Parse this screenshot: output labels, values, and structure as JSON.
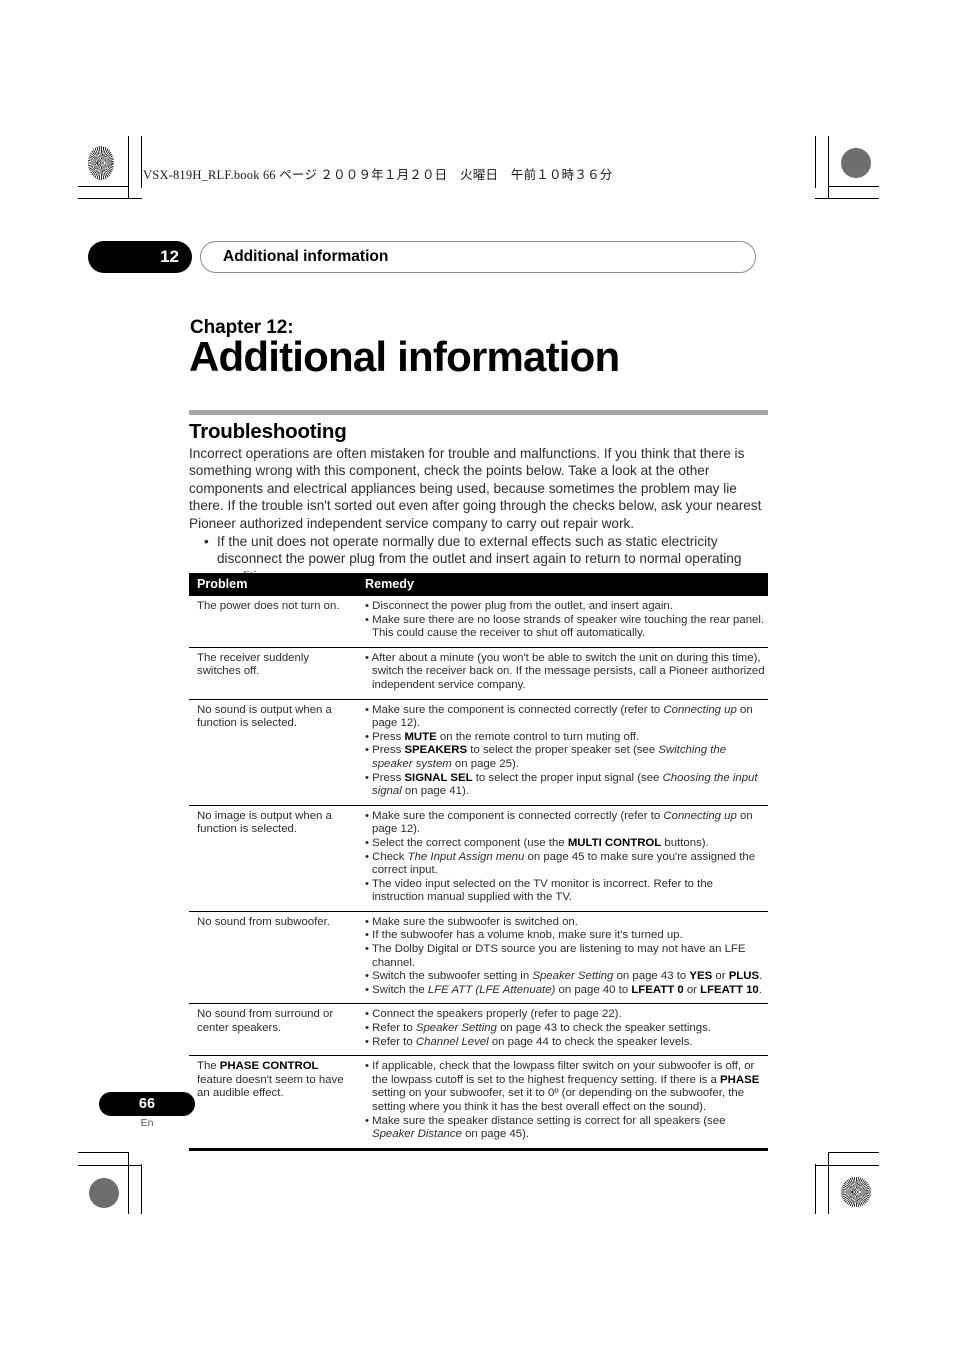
{
  "print_header": {
    "text": "VSX-819H_RLF.book  66 ページ  ２００９年１月２０日　火曜日　午前１０時３６分"
  },
  "running_head": {
    "chapter_number": "12",
    "title": "Additional information"
  },
  "chapter": {
    "label": "Chapter 12:",
    "title": "Additional information"
  },
  "section": {
    "title": "Troubleshooting",
    "intro_paragraph": "Incorrect operations are often mistaken for trouble and malfunctions. If you think that there is something wrong with this component, check the points below. Take a look at the other components and electrical appliances being used, because sometimes the problem may lie there. If the trouble isn't sorted out even after going through the checks below, ask your nearest Pioneer authorized independent service company to carry out repair work.",
    "intro_bullets": [
      "If the unit does not operate normally due to external effects such as static electricity disconnect the power plug from the outlet and insert again to return to normal operating conditions."
    ]
  },
  "table": {
    "headers": [
      "Problem",
      "Remedy"
    ],
    "rows": [
      {
        "problem_html": "The power does not turn on.",
        "remedies_html": [
          "Disconnect the power plug from the outlet, and insert again.",
          "Make sure there are no loose strands of speaker wire touching the rear panel. This could cause the receiver to shut off automatically."
        ]
      },
      {
        "problem_html": "The receiver suddenly switches off.",
        "remedies_html": [
          "After about a minute (you won't be able to switch the unit on during this time), switch the receiver back on. If the message persists, call a Pioneer authorized independent service company."
        ]
      },
      {
        "problem_html": "No sound is output when a function is selected.",
        "remedies_html": [
          "Make sure the component is connected correctly (refer to <i>Connecting up</i> on page 12).",
          "Press <b>MUTE</b> on the remote control to turn muting off.",
          "Press <b>SPEAKERS</b> to select the proper speaker set (see <i>Switching the speaker system</i> on page 25).",
          "Press <b>SIGNAL SEL</b> to select the proper input signal (see <i>Choosing the input signal</i> on page 41)."
        ]
      },
      {
        "problem_html": "No image is output when a function is selected.",
        "remedies_html": [
          "Make sure the component is connected correctly (refer to <i>Connecting up</i> on page 12).",
          "Select the correct component (use the <b>MULTI CONTROL</b> buttons).",
          "Check <i>The Input Assign menu</i> on page 45 to make sure you're assigned the correct input.",
          "The video input selected on the TV monitor is incorrect. Refer to the instruction manual supplied with the TV."
        ]
      },
      {
        "problem_html": "No sound from subwoofer.",
        "remedies_html": [
          "Make sure the subwoofer is switched on.",
          "If the subwoofer has a volume knob, make sure it's turned up.",
          "The Dolby Digital or DTS source you are listening to may not have an LFE channel.",
          "Switch the subwoofer setting in <i>Speaker Setting</i> on page 43 to <b>YES</b> or <b>PLUS</b>.",
          "Switch the <i>LFE ATT (LFE Attenuate)</i> on page 40 to <b>LFEATT 0</b> or <b>LFEATT 10</b>."
        ]
      },
      {
        "problem_html": "No sound from surround or center speakers.",
        "remedies_html": [
          "Connect the speakers properly (refer to page 22).",
          "Refer to <i>Speaker Setting</i> on page 43 to check the speaker settings.",
          "Refer to <i>Channel Level</i> on page 44 to check the speaker levels."
        ]
      },
      {
        "problem_html": "The <b>PHASE CONTROL</b> feature doesn't seem to have an audible effect.",
        "remedies_html": [
          "If applicable, check that the lowpass filter switch on your subwoofer is off, or the lowpass cutoff is set to the highest frequency setting. If there is a <b>PHASE</b> setting on your subwoofer, set it to 0º (or depending on the subwoofer, the setting where you think it has the best overall effect on the sound).",
          "Make sure the speaker distance setting is correct for all speakers (see <i>Speaker Distance</i> on page 45)."
        ]
      }
    ]
  },
  "footer": {
    "page_number": "66",
    "language_code": "En"
  },
  "colors": {
    "accent_black": "#000000",
    "section_rule_gray": "#a7a7a7",
    "body_text": "#2d2d2d"
  }
}
